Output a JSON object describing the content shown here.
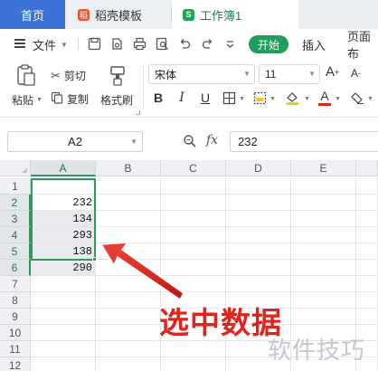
{
  "tabs": {
    "home": "首页",
    "doc": "稻壳模板",
    "doc_icon": "稻",
    "sheet": "工作簿1",
    "sheet_icon": "S"
  },
  "menu": {
    "file": "文件",
    "start": "开始",
    "insert": "插入",
    "page_layout": "页面布"
  },
  "ribbon": {
    "paste": "粘贴",
    "cut": "剪切",
    "copy": "复制",
    "format_painter": "格式刷",
    "font_name": "宋体",
    "font_size": "11",
    "bold": "B",
    "italic": "I",
    "underline": "U",
    "font_color_letter": "A",
    "font_color": "#e0241b",
    "fill_color": "#f5c518"
  },
  "formula_bar": {
    "cell_ref": "A2",
    "fx": "fx",
    "value": "232"
  },
  "grid": {
    "columns": [
      "A",
      "B",
      "C",
      "D",
      "E"
    ],
    "rows": [
      "1",
      "2",
      "3",
      "4",
      "5",
      "6",
      "7",
      "8",
      "9",
      "10",
      "11",
      "12"
    ],
    "selected_column": "A",
    "selected_rows": [
      "2",
      "3",
      "4",
      "5",
      "6"
    ],
    "column_a_values": [
      "232",
      "134",
      "293",
      "138",
      "290"
    ],
    "accent_color": "#2e9b58"
  },
  "annotation": {
    "text": "选中数据",
    "color": "#e0241b"
  },
  "watermark": {
    "text": "软件技巧"
  }
}
